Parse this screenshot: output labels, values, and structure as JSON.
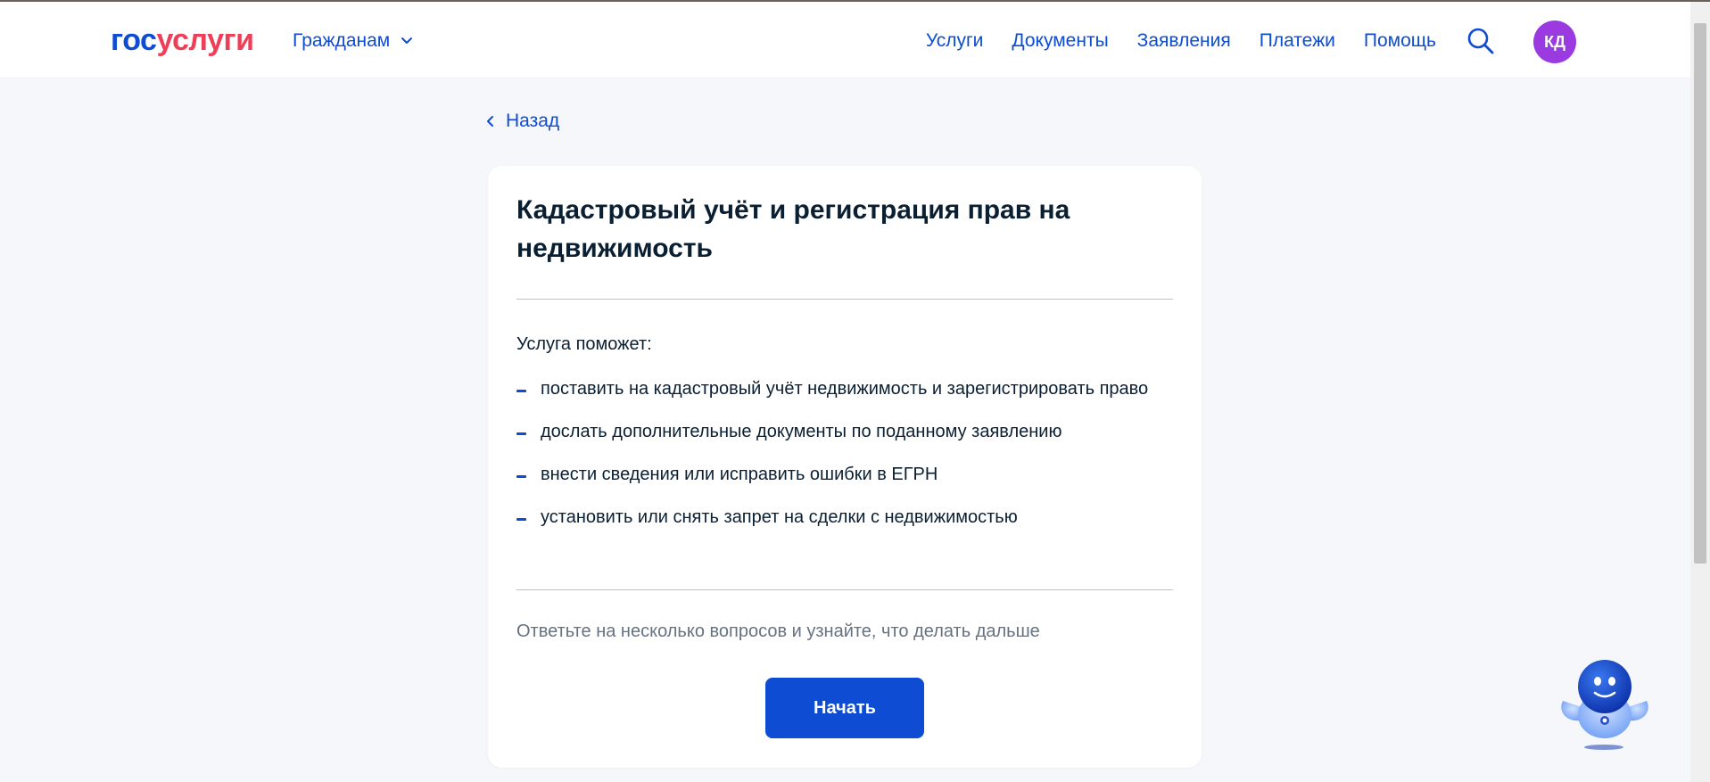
{
  "header": {
    "logo": {
      "part1": "гос",
      "part2": "услуги"
    },
    "audience_label": "Гражданам",
    "nav": [
      "Услуги",
      "Документы",
      "Заявления",
      "Платежи",
      "Помощь"
    ],
    "avatar_initials": "КД"
  },
  "back_label": "Назад",
  "card": {
    "title": "Кадастровый учёт и регистрация прав на недвижимость",
    "intro": "Услуга поможет:",
    "items": [
      "поставить на кадастровый учёт недвижимость и зарегистрировать право",
      "дослать дополнительные документы по поданному заявлению",
      "внести сведения или исправить ошибки в ЕГРН",
      "установить или снять запрет на сделки с недвижимостью"
    ],
    "hint": "Ответьте на несколько вопросов и узнайте, что делать дальше",
    "start_label": "Начать"
  },
  "colors": {
    "brand_blue": "#0d4cd3",
    "brand_red": "#ee3f58",
    "avatar": "#9a3ae0",
    "background": "#f5f7fa"
  },
  "icons": [
    "chevron-down-icon",
    "search-icon",
    "chevron-left-icon",
    "robot-assistant-icon"
  ]
}
